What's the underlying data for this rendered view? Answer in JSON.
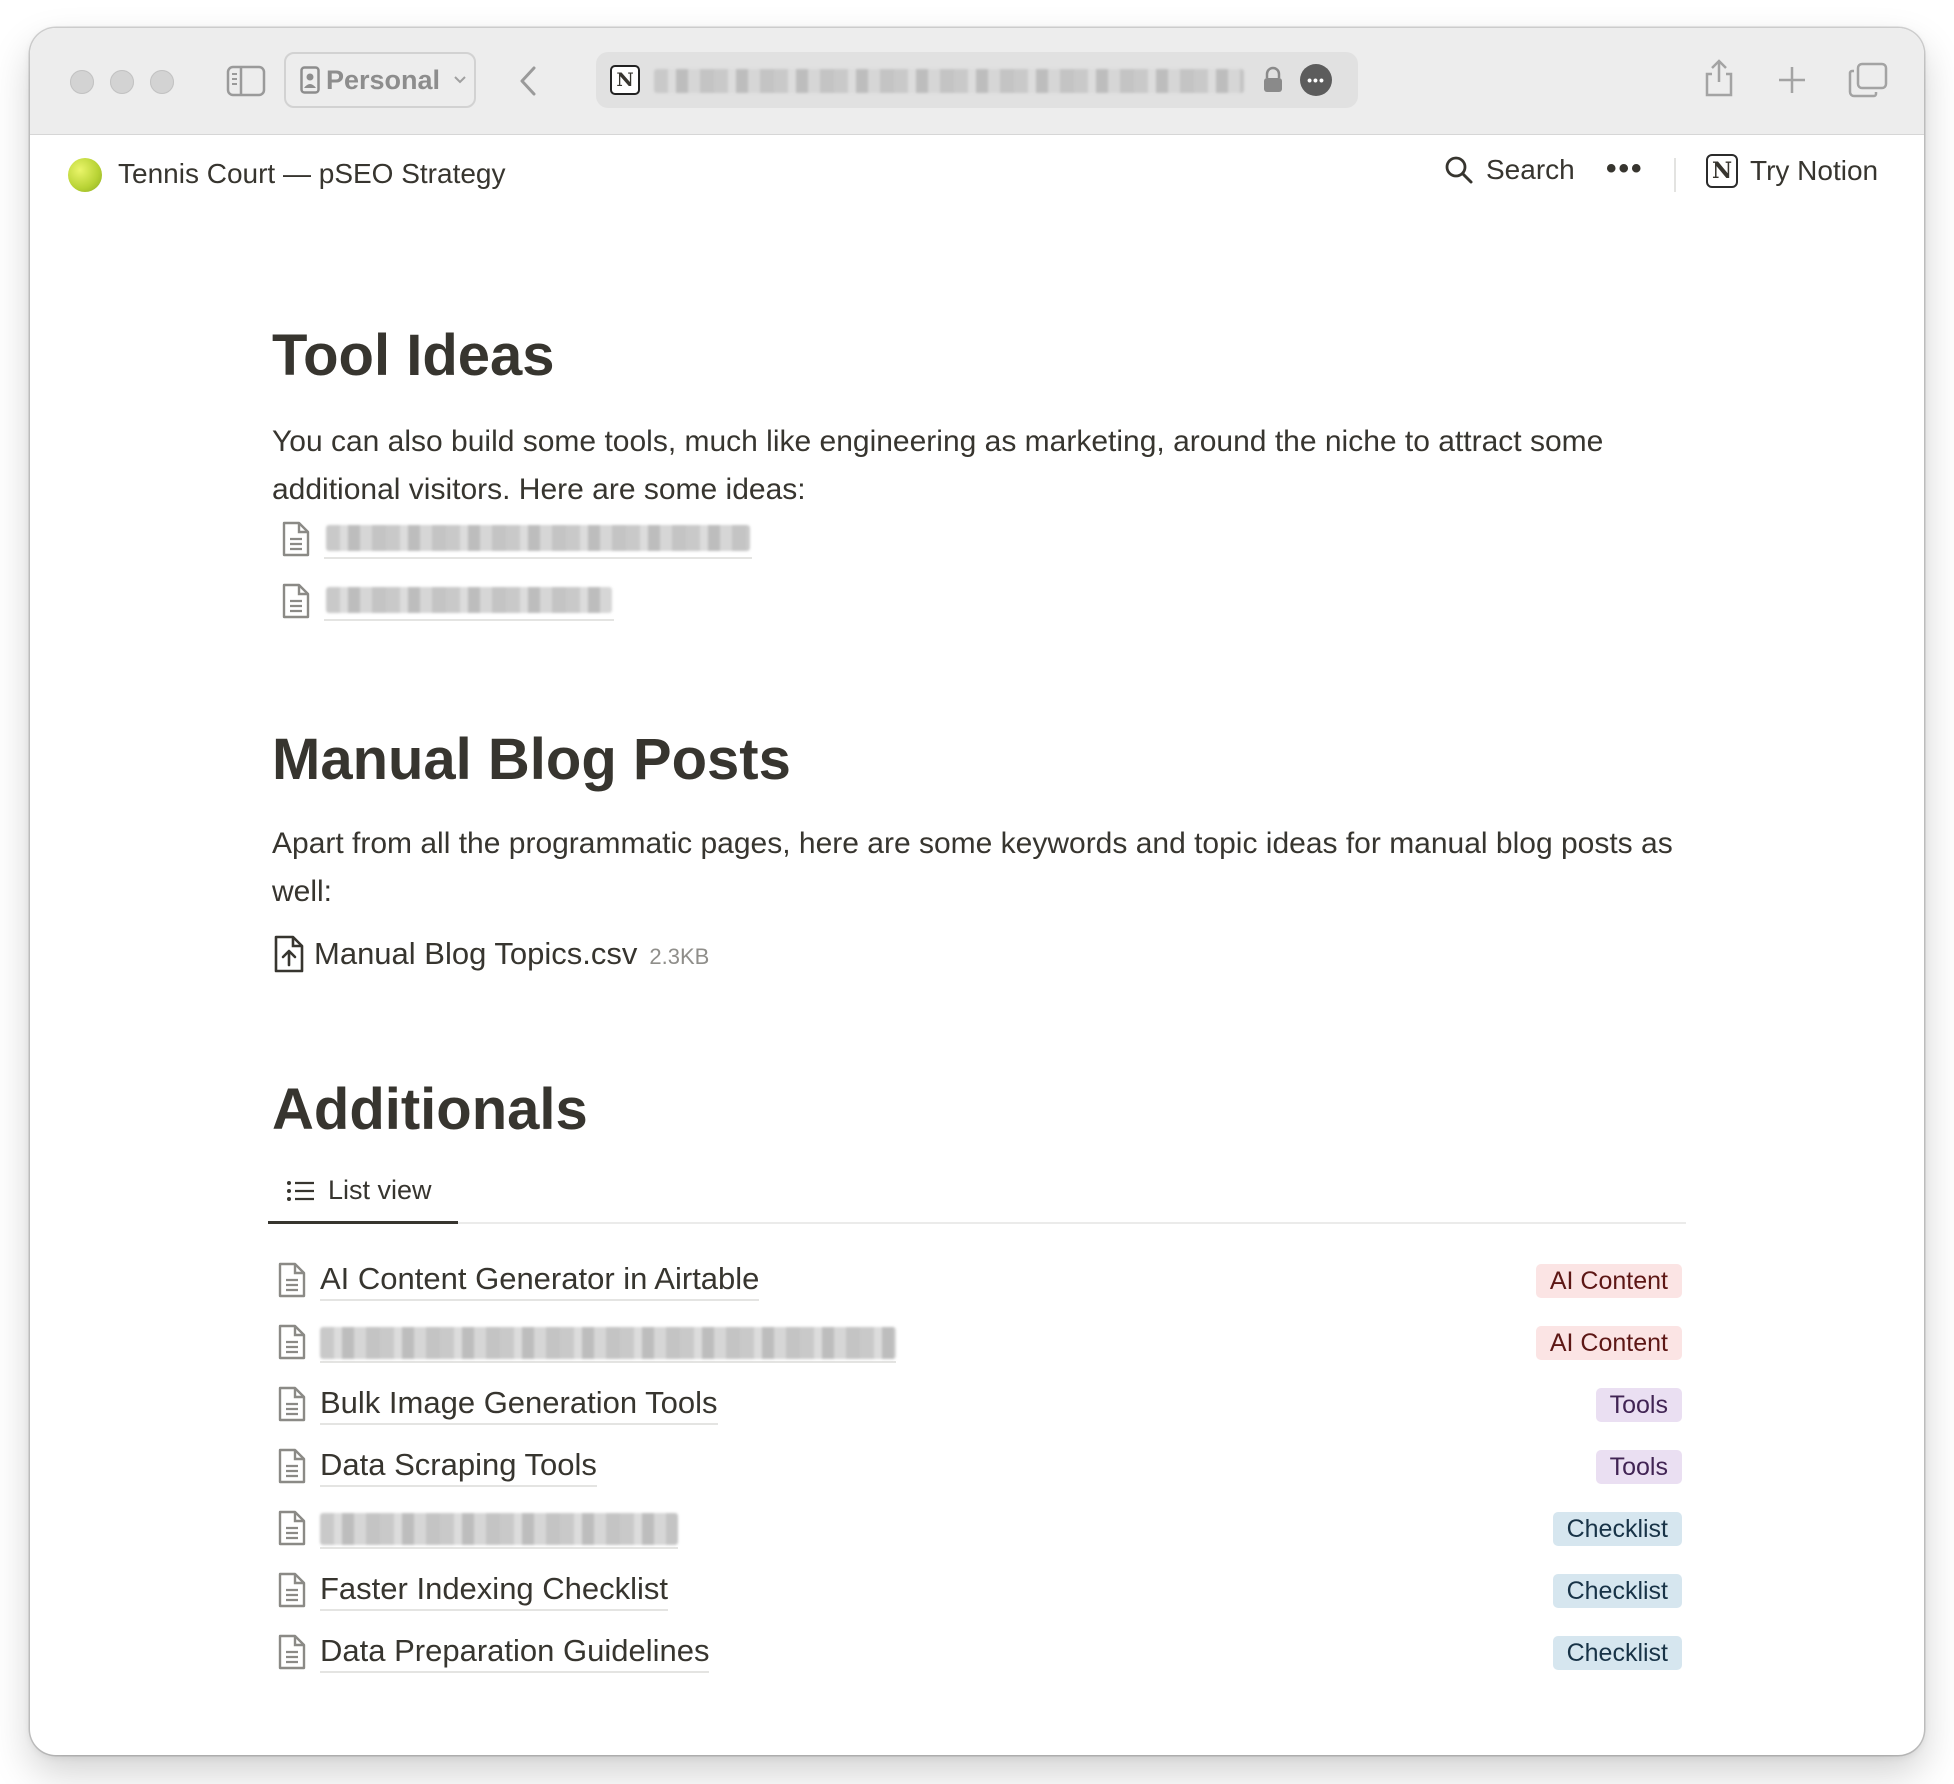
{
  "browser": {
    "profile_label": "Personal",
    "url_text": ""
  },
  "header": {
    "page_title": "Tennis Court — pSEO Strategy",
    "search_label": "Search",
    "more_label": "•••",
    "try_notion_label": "Try Notion"
  },
  "tool_ideas": {
    "heading": "Tool Ideas",
    "paragraph": "You can also build some tools, much like engineering as marketing, around the niche to attract some additional visitors. Here are some ideas:",
    "links": [
      {
        "title": ""
      },
      {
        "title": ""
      }
    ]
  },
  "manual_blog": {
    "heading": "Manual Blog Posts",
    "paragraph": "Apart from all the programmatic pages, here are some keywords and topic ideas for manual blog posts as well:",
    "file": {
      "name": "Manual Blog Topics.csv",
      "size": "2.3KB"
    }
  },
  "additionals": {
    "heading": "Additionals",
    "view_tab": "List view",
    "rows": [
      {
        "title": "AI Content Generator in Airtable",
        "tag": "AI Content"
      },
      {
        "title": "",
        "tag": "AI Content"
      },
      {
        "title": "Bulk Image Generation Tools",
        "tag": "Tools"
      },
      {
        "title": "Data Scraping Tools",
        "tag": "Tools"
      },
      {
        "title": "",
        "tag": "Checklist"
      },
      {
        "title": "Faster Indexing Checklist",
        "tag": "Checklist"
      },
      {
        "title": "Data Preparation Guidelines",
        "tag": "Checklist"
      }
    ]
  },
  "colors": {
    "text": "#37352f",
    "tag_ai_content_bg": "#fbe4e4",
    "tag_ai_content_fg": "#5d1715",
    "tag_tools_bg": "#eadff2",
    "tag_tools_fg": "#412454",
    "tag_checklist_bg": "#d6e6ef",
    "tag_checklist_fg": "#183347"
  }
}
